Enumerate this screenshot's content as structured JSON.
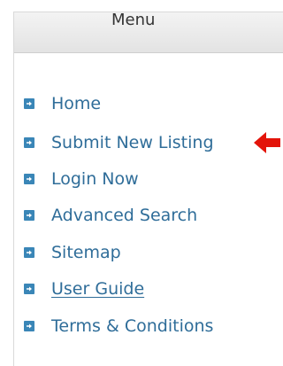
{
  "menu": {
    "title": "Menu",
    "items": [
      {
        "label": "Home",
        "underlined": false
      },
      {
        "label": "Submit New Listing",
        "underlined": false
      },
      {
        "label": "Login Now",
        "underlined": false
      },
      {
        "label": "Advanced Search",
        "underlined": false
      },
      {
        "label": "Sitemap",
        "underlined": false
      },
      {
        "label": "User Guide",
        "underlined": true
      },
      {
        "label": "Terms & Conditions",
        "underlined": false
      }
    ]
  },
  "colors": {
    "link": "#2f6d99",
    "bullet": "#3a86b7",
    "annotation_arrow": "#e3140a"
  },
  "icons": {
    "bullet": "right-arrow-square-icon",
    "annotation": "red-arrow-pointer-icon"
  }
}
